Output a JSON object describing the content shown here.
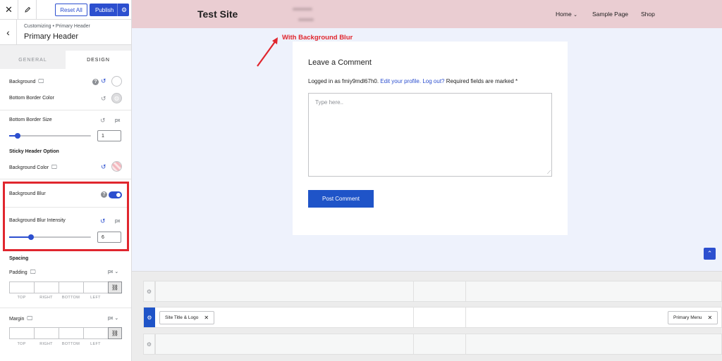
{
  "topbar": {
    "reset_label": "Reset All",
    "publish_label": "Publish"
  },
  "crumb": {
    "path": "Customizing • Primary Header",
    "title": "Primary Header"
  },
  "tabs": [
    {
      "label": "GENERAL"
    },
    {
      "label": "DESIGN"
    }
  ],
  "panel": {
    "background_label": "Background",
    "bottom_border_color_label": "Bottom Border Color",
    "bottom_border_size_label": "Bottom Border Size",
    "bottom_border_size_unit": "px",
    "bottom_border_size_value": "1",
    "bottom_border_size_level": 0.1,
    "sticky_section": "Sticky Header Option",
    "sticky_bg_label": "Background Color",
    "blur_label": "Background Blur",
    "blur_enabled": true,
    "blur_intensity_label": "Background Blur Intensity",
    "blur_intensity_unit": "px",
    "blur_intensity_value": "6",
    "blur_intensity_level": 0.27,
    "spacing_section": "Spacing",
    "padding_label": "Padding",
    "padding_unit": "px",
    "margin_label": "Margin",
    "margin_unit": "px",
    "side_labels": [
      "TOP",
      "RIGHT",
      "BOTTOM",
      "LEFT"
    ]
  },
  "colors": {
    "accent": "#2c4fcf",
    "highlight": "#e0262e",
    "header_bg": "#eacdd2"
  },
  "preview": {
    "site_title": "Test Site",
    "nav": [
      {
        "label": "Home"
      },
      {
        "label": "Sample Page"
      },
      {
        "label": "Shop"
      }
    ],
    "annotation": "With Background Blur",
    "comment_heading": "Leave a Comment",
    "logged_prefix": "Logged in as fmiy9mdl67h0.",
    "edit_profile": "Edit your profile.",
    "logout": "Log out?",
    "required_note": "Required fields are marked *",
    "textarea_placeholder": "Type here..",
    "post_button": "Post Comment"
  },
  "builder": {
    "chip_site_title": "Site Title & Logo",
    "chip_primary_menu": "Primary Menu"
  }
}
